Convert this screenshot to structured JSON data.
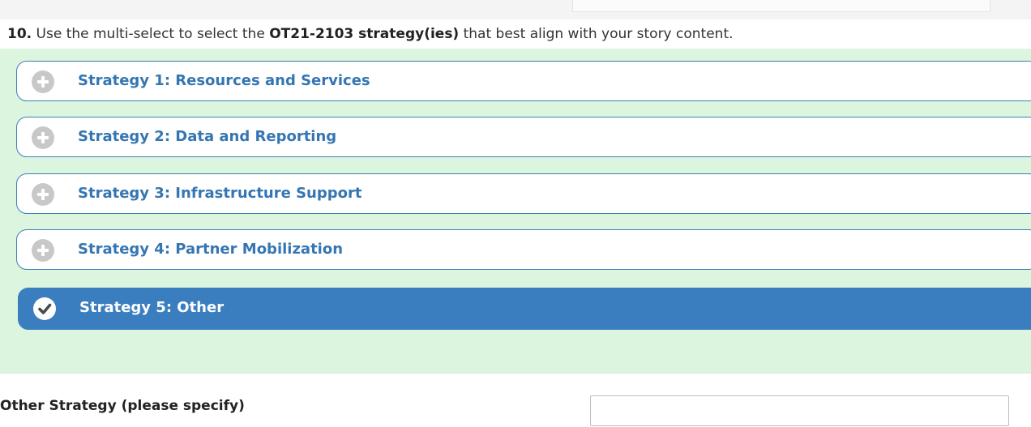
{
  "question": {
    "number": "10.",
    "text_before": " Use the multi-select to select the ",
    "bold_text": "OT21-2103 strategy(ies)",
    "text_after": " that best align with your story content."
  },
  "options": [
    {
      "label": "Strategy 1: Resources and Services",
      "selected": false,
      "icon": "plus-icon"
    },
    {
      "label": "Strategy 2: Data and Reporting",
      "selected": false,
      "icon": "plus-icon"
    },
    {
      "label": "Strategy 3: Infrastructure Support",
      "selected": false,
      "icon": "plus-icon"
    },
    {
      "label": "Strategy 4: Partner Mobilization",
      "selected": false,
      "icon": "plus-icon"
    },
    {
      "label": "Strategy 5: Other",
      "selected": true,
      "icon": "checkmark-icon"
    }
  ],
  "other": {
    "label": "Other Strategy (please specify)",
    "value": "",
    "placeholder": ""
  },
  "colors": {
    "accent": "#3a7ebf",
    "option_text": "#3576b2",
    "options_background": "#dbf5df",
    "unselected_icon": "#c8c8c8"
  }
}
